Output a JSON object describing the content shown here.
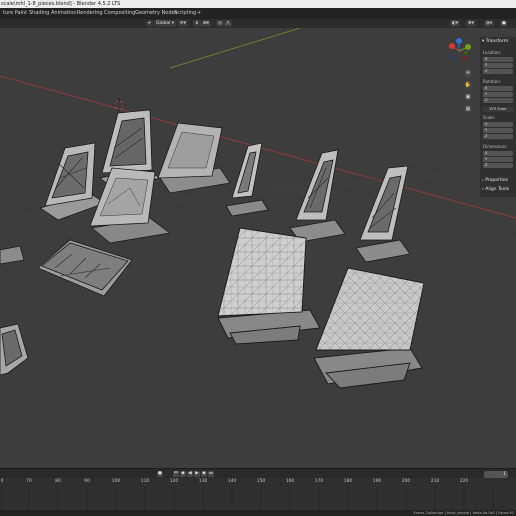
{
  "window": {
    "title": "scale\\mhl_1-8_pieces.blend] - Blender 4.5.2 LTS"
  },
  "workspace_tabs": [
    {
      "label": "ture Paint"
    },
    {
      "label": "Shading"
    },
    {
      "label": "Animation"
    },
    {
      "label": "Rendering"
    },
    {
      "label": "Compositing"
    },
    {
      "label": "Geometry Nodes"
    },
    {
      "label": "Scripting"
    },
    {
      "label": "+"
    }
  ],
  "viewport_header": {
    "orientation": "Global"
  },
  "gizmo": {
    "axes": [
      {
        "label": "Z",
        "color": "#2f6fd6"
      },
      {
        "label": "Y",
        "color": "#6aa31a"
      },
      {
        "label": "X",
        "color": "#d03a3a"
      }
    ]
  },
  "npanel": {
    "transform_title": "Transform",
    "location_label": "Location:",
    "location_fields": [
      "X",
      "Y",
      "Z"
    ],
    "rotation_label": "Rotation:",
    "rotation_fields": [
      "X",
      "Y",
      "Z"
    ],
    "rotation_mode": "XYZ Euler",
    "scale_label": "Scale:",
    "scale_fields": [
      "X",
      "Y",
      "Z"
    ],
    "dimensions_label": "Dimensions:",
    "dimensions_fields": [
      "X",
      "Y",
      "Z"
    ],
    "properties_label": "Properties",
    "align_tools_label": "Align Tools"
  },
  "timeline": {
    "current_frame": "1",
    "ticks": [
      "0",
      "70",
      "80",
      "90",
      "100",
      "110",
      "120",
      "130",
      "140",
      "150",
      "160",
      "170",
      "180",
      "190",
      "200",
      "210",
      "220"
    ]
  },
  "statusbar": {
    "text": "Scene Collection | front_simple | Verts:4a,Fa0 | Faces:91"
  }
}
